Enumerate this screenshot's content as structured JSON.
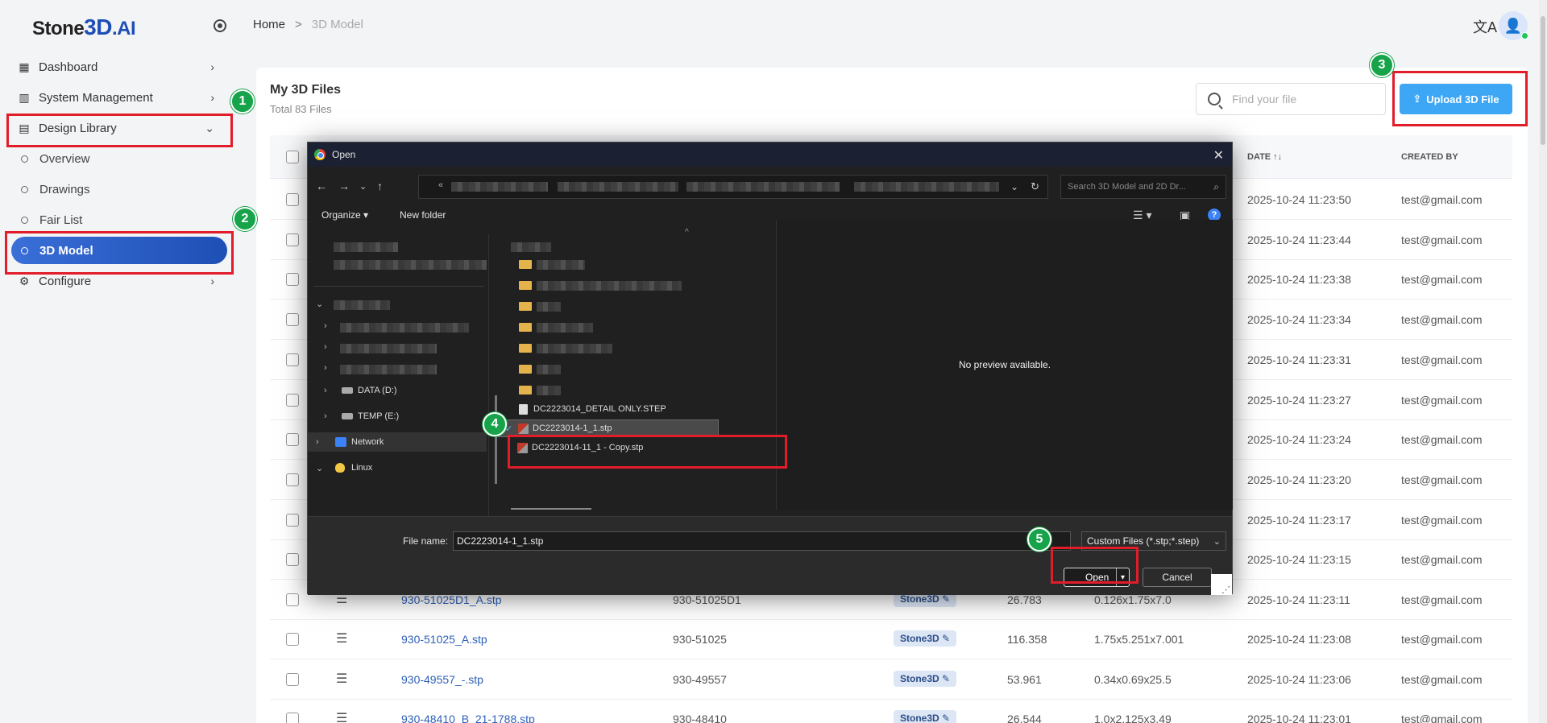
{
  "sidebar": {
    "logo_prefix": "Stone",
    "logo_3d": "3D",
    "logo_suffix": ".AI",
    "items": [
      {
        "label": "Dashboard",
        "icon": "grid-icon"
      },
      {
        "label": "System Management",
        "icon": "building-icon"
      },
      {
        "label": "Design Library",
        "icon": "library-icon"
      },
      {
        "label": "Configure",
        "icon": "gear-icon"
      }
    ],
    "sub_items": [
      {
        "label": "Overview"
      },
      {
        "label": "Drawings"
      },
      {
        "label": "Fair List"
      },
      {
        "label": "3D Model",
        "active": true
      }
    ]
  },
  "breadcrumb": {
    "home": "Home",
    "separator": ">",
    "current": "3D Model"
  },
  "header": {
    "translate_icon": "translate-icon",
    "avatar_icon": "user-icon"
  },
  "files": {
    "title": "My 3D Files",
    "subtitle": "Total 83 Files",
    "search_placeholder": "Find your file",
    "upload_label": "Upload 3D File"
  },
  "table": {
    "headers": {
      "date": "DATE ↑↓",
      "created_by": "CREATED BY"
    },
    "rows": [
      {
        "date": "2025-10-24 11:23:50",
        "created_by": "test@gmail.com"
      },
      {
        "date": "2025-10-24 11:23:44",
        "created_by": "test@gmail.com"
      },
      {
        "date": "2025-10-24 11:23:38",
        "created_by": "test@gmail.com"
      },
      {
        "date": "2025-10-24 11:23:34",
        "created_by": "test@gmail.com"
      },
      {
        "date": "2025-10-24 11:23:31",
        "created_by": "test@gmail.com"
      },
      {
        "date": "2025-10-24 11:23:27",
        "created_by": "test@gmail.com"
      },
      {
        "date": "2025-10-24 11:23:24",
        "created_by": "test@gmail.com"
      },
      {
        "date": "2025-10-24 11:23:20",
        "created_by": "test@gmail.com"
      },
      {
        "date": "2025-10-24 11:23:17",
        "created_by": "test@gmail.com"
      },
      {
        "date": "2025-10-24 11:23:15",
        "created_by": "test@gmail.com"
      },
      {
        "name": "930-51025D1_A.stp",
        "part": "930-51025D1",
        "tag": "Stone3D",
        "value": "26.783",
        "dims": "0.126x1.75x7.0",
        "date": "2025-10-24 11:23:11",
        "created_by": "test@gmail.com"
      },
      {
        "name": "930-51025_A.stp",
        "part": "930-51025",
        "tag": "Stone3D",
        "value": "116.358",
        "dims": "1.75x5.251x7.001",
        "date": "2025-10-24 11:23:08",
        "created_by": "test@gmail.com"
      },
      {
        "name": "930-49557_-.stp",
        "part": "930-49557",
        "tag": "Stone3D",
        "value": "53.961",
        "dims": "0.34x0.69x25.5",
        "date": "2025-10-24 11:23:06",
        "created_by": "test@gmail.com"
      },
      {
        "name": "930-48410_B_21-1788.stp",
        "part": "930-48410",
        "tag": "Stone3D",
        "value": "26.544",
        "dims": "1.0x2.125x3.49",
        "date": "2025-10-24 11:23:01",
        "created_by": "test@gmail.com"
      }
    ]
  },
  "dialog": {
    "title": "Open",
    "close": "✕",
    "search_placeholder": "Search 3D Model and 2D Dr...",
    "organize": "Organize ▾",
    "new_folder": "New folder",
    "tree": [
      {
        "label": "DATA (D:)"
      },
      {
        "label": "TEMP (E:)"
      },
      {
        "label": "Network"
      },
      {
        "label": "Linux"
      }
    ],
    "files": [
      {
        "label": "DC2223014_DETAIL ONLY.STEP"
      },
      {
        "label": "DC2223014-1_1.stp",
        "selected": true
      },
      {
        "label": "DC2223014-11_1 - Copy.stp"
      }
    ],
    "preview_text": "No preview available.",
    "file_name_label": "File name:",
    "file_name_value": "DC2223014-1_1.stp",
    "file_type": "Custom Files (*.stp;*.step)",
    "open_label": "Open",
    "cancel_label": "Cancel"
  },
  "annotations": [
    "1",
    "2",
    "3",
    "4",
    "5"
  ],
  "colors": {
    "accent": "#1e4fb5",
    "upload": "#3ea7f5",
    "highlight": "#e11d2a",
    "badge": "#17a34a"
  }
}
